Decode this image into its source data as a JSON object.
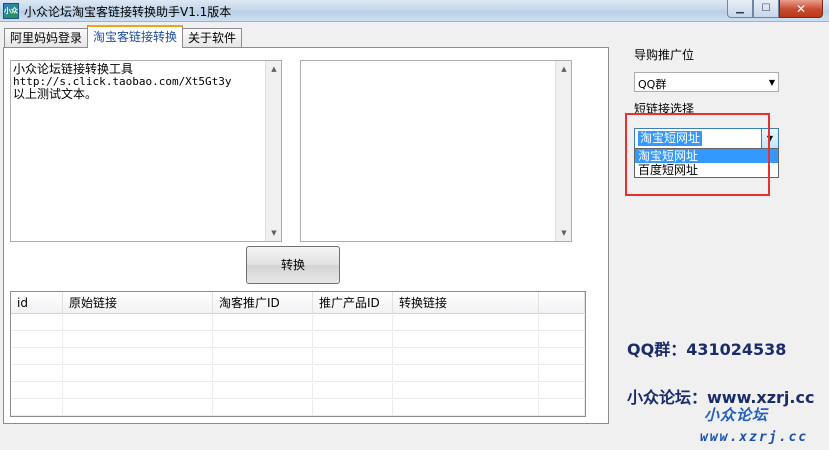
{
  "window": {
    "title": "小众论坛淘宝客链接转换助手V1.1版本",
    "icon_label": "小众"
  },
  "tabs": [
    {
      "label": "阿里妈妈登录",
      "active": false
    },
    {
      "label": "淘宝客链接转换",
      "active": true
    },
    {
      "label": "关于软件",
      "active": false
    }
  ],
  "input_box": {
    "lines": [
      "小众论坛链接转换工具",
      "http://s.click.taobao.com/Xt5Gt3y",
      "以上测试文本。"
    ]
  },
  "output_box": {
    "text": ""
  },
  "convert_button": {
    "label": "转换"
  },
  "table": {
    "columns": [
      "id",
      "原始链接",
      "淘客推广ID",
      "推广产品ID",
      "转换链接",
      ""
    ],
    "rows": []
  },
  "settings": {
    "promo_label": "导购推广位",
    "promo_value": "QQ群",
    "shortlink_label": "短链接选择",
    "shortlink_value": "淘宝短网址",
    "shortlink_options": [
      "淘宝短网址",
      "百度短网址"
    ]
  },
  "info": {
    "qq": "QQ群：431024538",
    "forum": "小众论坛：www.xzrj.cc",
    "logo_cn": "小众论坛",
    "logo_url": "www.xzrj.cc"
  },
  "colors": {
    "highlight": "#3399ff",
    "annotation_box": "#e83030",
    "info_text": "#1a2c6a"
  }
}
